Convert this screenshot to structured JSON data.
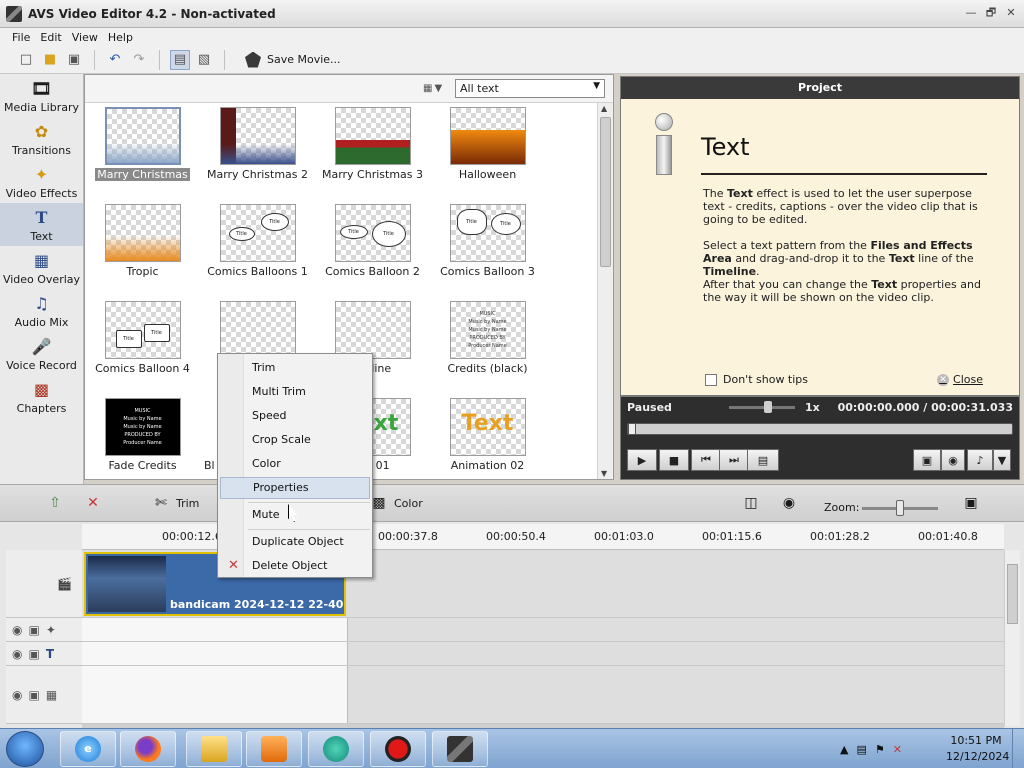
{
  "window": {
    "title": "AVS Video Editor 4.2 - Non-activated",
    "controls": [
      "—",
      "🗗",
      "✕"
    ]
  },
  "menu": [
    "File",
    "Edit",
    "View",
    "Help"
  ],
  "toolbar": {
    "save_movie": "Save Movie..."
  },
  "sidebar": {
    "items": [
      {
        "label": "Media Library",
        "icon": "film-icon"
      },
      {
        "label": "Transitions",
        "icon": "transitions-icon"
      },
      {
        "label": "Video Effects",
        "icon": "video-effects-icon"
      },
      {
        "label": "Text",
        "icon": "text-icon",
        "selected": true
      },
      {
        "label": "Video Overlay",
        "icon": "video-overlay-icon"
      },
      {
        "label": "Audio Mix",
        "icon": "audio-mix-icon"
      },
      {
        "label": "Voice Record",
        "icon": "microphone-icon"
      },
      {
        "label": "Chapters",
        "icon": "chapters-icon"
      }
    ]
  },
  "effects": {
    "filter_value": "All text",
    "tiles": [
      {
        "label": "Marry Christmas",
        "selected": true
      },
      {
        "label": "Marry Christmas 2"
      },
      {
        "label": "Marry Christmas 3"
      },
      {
        "label": "Halloween"
      },
      {
        "label": "Tropic"
      },
      {
        "label": "Comics Balloons 1"
      },
      {
        "label": "Comics Balloon 2"
      },
      {
        "label": "Comics Balloon 3"
      },
      {
        "label": "Comics Balloon 4"
      },
      {
        "label": ""
      },
      {
        "label": "ng line"
      },
      {
        "label": "Credits (black)"
      },
      {
        "label": "Fade Credits"
      },
      {
        "label": "Bl"
      },
      {
        "label": "ion 01"
      },
      {
        "label": "Animation 02"
      }
    ],
    "thumb_text": {
      "balloon": "Title",
      "credits_lines": [
        "MUSIC",
        "Music by Name",
        "Music by Name",
        "PRODUCED BY",
        "Producer Name"
      ],
      "animation_word": "Text"
    }
  },
  "project": {
    "header": "Project",
    "title": "Text",
    "para1_pre": "The ",
    "para1_b": "Text",
    "para1_post": " effect is used to let the user superpose text - credits, captions - over the video clip that is going to be edited.",
    "para2_pre": "Select a text pattern from the ",
    "para2_b1": "Files and Effects Area",
    "para2_mid": " and drag-and-drop it to the ",
    "para2_b2": "Text",
    "para2_mid2": " line of the ",
    "para2_b3": "Timeline",
    "para2_post": ".",
    "para3_pre": "After that you can change the ",
    "para3_b": "Text",
    "para3_post": " properties and the way it will be shown on the video clip.",
    "dont_show": "Don't show tips",
    "close": "Close"
  },
  "player": {
    "status": "Paused",
    "speed": "1x",
    "time": "00:00:00.000  /  00:00:31.033",
    "speed_fraction": 0.6,
    "seek_fraction": 0.0
  },
  "timeline_toolbar": {
    "trim": "Trim",
    "color": "Color",
    "zoom": "Zoom:",
    "zoom_fraction": 0.5
  },
  "ruler_ticks": [
    "00:00:12.6",
    "00:00:37.8",
    "00:00:50.4",
    "00:01:03.0",
    "00:01:15.6",
    "00:01:28.2",
    "00:01:40.8"
  ],
  "clip": {
    "name": "bandicam 2024-12-12 22-40-..."
  },
  "context_menu": {
    "items": [
      "Trim",
      "Multi Trim",
      "Speed",
      "Crop Scale",
      "Color",
      "Properties",
      "Mute",
      "Duplicate Object",
      "Delete Object"
    ],
    "hovered": "Properties"
  },
  "taskbar": {
    "apps": [
      "internet-explorer-icon",
      "firefox-icon",
      "file-explorer-icon",
      "media-player-icon",
      "teams-icon",
      "bandicam-record-icon",
      "avs-video-editor-icon"
    ],
    "time": "10:51 PM",
    "date": "12/12/2024"
  },
  "colors": {
    "project_bg": "#fcf3dc",
    "player_bg": "#2e2e2e",
    "clip_border": "#e1c200",
    "selected_sidebar": "#c9d2de",
    "context_hover": "#d8e2ef"
  }
}
